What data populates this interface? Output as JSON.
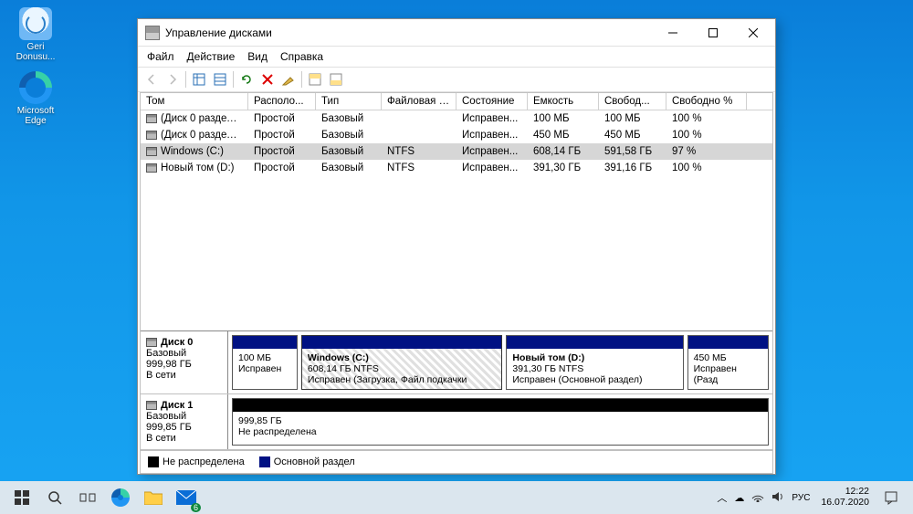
{
  "desktop": {
    "icons": [
      {
        "name": "recycle-bin",
        "label": "Geri Donusu..."
      },
      {
        "name": "edge",
        "label": "Microsoft Edge"
      }
    ]
  },
  "window": {
    "title": "Управление дисками"
  },
  "menu": [
    "Файл",
    "Действие",
    "Вид",
    "Справка"
  ],
  "columns": [
    "Том",
    "Располо...",
    "Тип",
    "Файловая с...",
    "Состояние",
    "Емкость",
    "Свобод...",
    "Свободно %"
  ],
  "volumes": [
    {
      "name": "(Диск 0 раздел 1)",
      "layout": "Простой",
      "type": "Базовый",
      "fs": "",
      "status": "Исправен...",
      "capacity": "100 МБ",
      "free": "100 МБ",
      "pct": "100 %"
    },
    {
      "name": "(Диск 0 раздел 4)",
      "layout": "Простой",
      "type": "Базовый",
      "fs": "",
      "status": "Исправен...",
      "capacity": "450 МБ",
      "free": "450 МБ",
      "pct": "100 %"
    },
    {
      "name": "Windows (C:)",
      "layout": "Простой",
      "type": "Базовый",
      "fs": "NTFS",
      "status": "Исправен...",
      "capacity": "608,14 ГБ",
      "free": "591,58 ГБ",
      "pct": "97 %",
      "selected": true
    },
    {
      "name": "Новый том (D:)",
      "layout": "Простой",
      "type": "Базовый",
      "fs": "NTFS",
      "status": "Исправен...",
      "capacity": "391,30 ГБ",
      "free": "391,16 ГБ",
      "pct": "100 %"
    }
  ],
  "disks": [
    {
      "name": "Диск 0",
      "type": "Базовый",
      "size": "999,98 ГБ",
      "status": "В сети",
      "partitions": [
        {
          "title": "",
          "line1": "100 МБ",
          "line2": "Исправен",
          "kind": "navy",
          "flex": 8
        },
        {
          "title": "Windows  (C:)",
          "line1": "608,14 ГБ NTFS",
          "line2": "Исправен (Загрузка, Файл подкачки",
          "kind": "navy",
          "flex": 25,
          "selected": true
        },
        {
          "title": "Новый том  (D:)",
          "line1": "391,30 ГБ NTFS",
          "line2": "Исправен (Основной раздел)",
          "kind": "navy",
          "flex": 22
        },
        {
          "title": "",
          "line1": "450 МБ",
          "line2": "Исправен (Разд",
          "kind": "navy",
          "flex": 10
        }
      ]
    },
    {
      "name": "Диск 1",
      "type": "Базовый",
      "size": "999,85 ГБ",
      "status": "В сети",
      "partitions": [
        {
          "title": "",
          "line1": "999,85 ГБ",
          "line2": "Не распределена",
          "kind": "black",
          "flex": 1
        }
      ]
    }
  ],
  "legend": [
    {
      "label": "Не распределена",
      "cls": "black"
    },
    {
      "label": "Основной раздел",
      "cls": "navy"
    }
  ],
  "taskbar": {
    "mail_badge": "6",
    "time": "12:22",
    "date": "16.07.2020"
  }
}
